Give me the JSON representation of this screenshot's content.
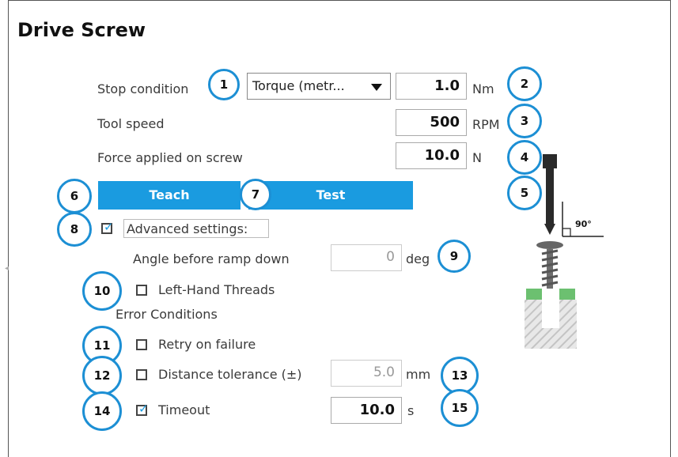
{
  "title": "Drive Screw",
  "stop_condition": {
    "label": "Stop condition",
    "select_value": "Torque (metr...",
    "value": "1.0",
    "unit": "Nm"
  },
  "tool_speed": {
    "label": "Tool speed",
    "value": "500",
    "unit": "RPM"
  },
  "force": {
    "label": "Force applied on screw",
    "value": "10.0",
    "unit": "N"
  },
  "buttons": {
    "teach": "Teach",
    "test": "Test"
  },
  "advanced": {
    "label": "Advanced settings:",
    "checked": true
  },
  "angle": {
    "label": "Angle before ramp down",
    "value": "0",
    "unit": "deg"
  },
  "left_hand": {
    "label": "Left-Hand Threads",
    "checked": false
  },
  "error_heading": "Error Conditions",
  "retry": {
    "label": "Retry on failure",
    "checked": false
  },
  "distance": {
    "label": "Distance tolerance (±)",
    "value": "5.0",
    "unit": "mm",
    "checked": false
  },
  "timeout": {
    "label": "Timeout",
    "value": "10.0",
    "unit": "s",
    "checked": true
  },
  "diagram": {
    "angle_label": "90°"
  },
  "callouts": [
    "1",
    "2",
    "3",
    "4",
    "5",
    "6",
    "7",
    "8",
    "9",
    "10",
    "11",
    "12",
    "13",
    "14",
    "15"
  ],
  "colors": {
    "accent": "#1a9be0",
    "callout_border": "#1c8fd4",
    "green": "#6cc070",
    "hatch": "#cfcfcf"
  }
}
